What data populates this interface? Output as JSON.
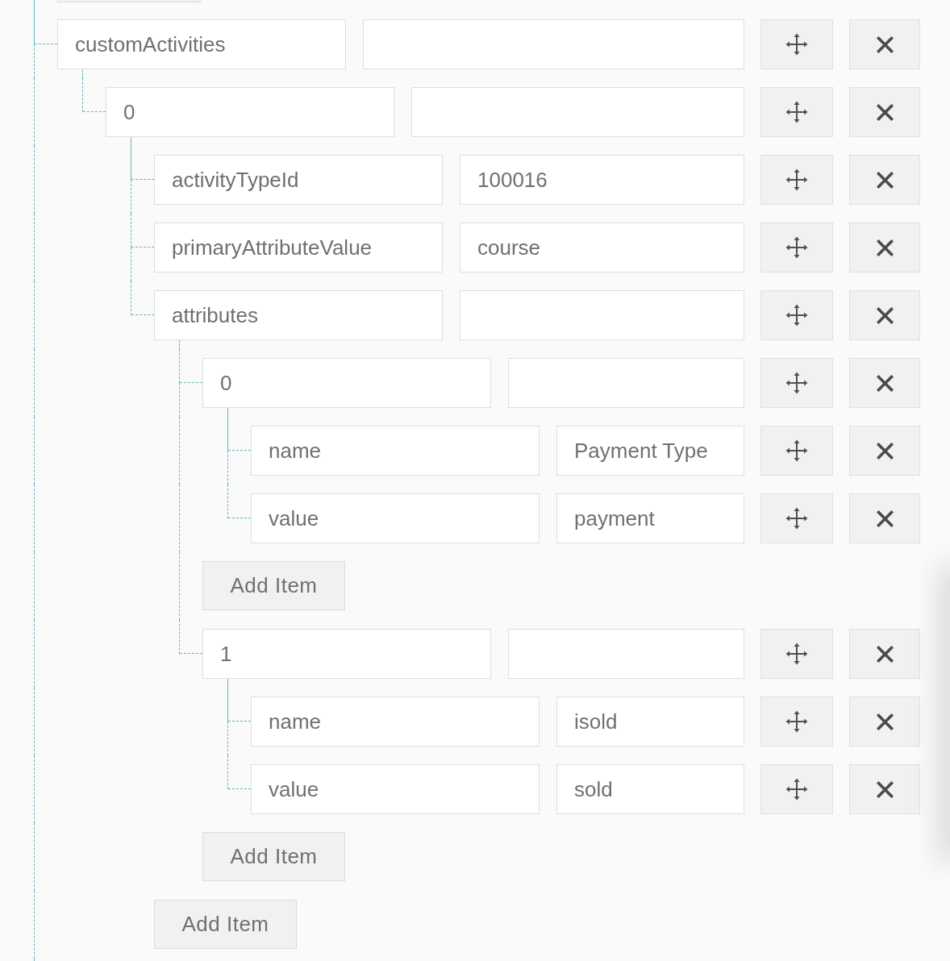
{
  "tree": {
    "kind": "object",
    "continues_below": true,
    "items": [
      {
        "key": "customActivities",
        "kind": "array",
        "children": [
          {
            "key": "0",
            "kind": "object",
            "children": [
              {
                "key": "activityTypeId",
                "kind": "text",
                "value": "100016"
              },
              {
                "key": "primaryAttributeValue",
                "kind": "text",
                "value": "course"
              },
              {
                "key": "attributes",
                "kind": "array",
                "add_label": "Add Item",
                "children": [
                  {
                    "key": "0",
                    "kind": "object",
                    "add_label": "Add Item",
                    "children": [
                      {
                        "key": "name",
                        "kind": "text",
                        "value": "Payment Type"
                      },
                      {
                        "key": "value",
                        "kind": "text",
                        "value": "payment"
                      }
                    ]
                  },
                  {
                    "key": "1",
                    "kind": "object",
                    "add_label": "Add Item",
                    "children": [
                      {
                        "key": "name",
                        "kind": "text",
                        "value": "isold"
                      },
                      {
                        "key": "value",
                        "kind": "text",
                        "value": "sold"
                      }
                    ]
                  }
                ]
              }
            ]
          }
        ]
      }
    ]
  }
}
